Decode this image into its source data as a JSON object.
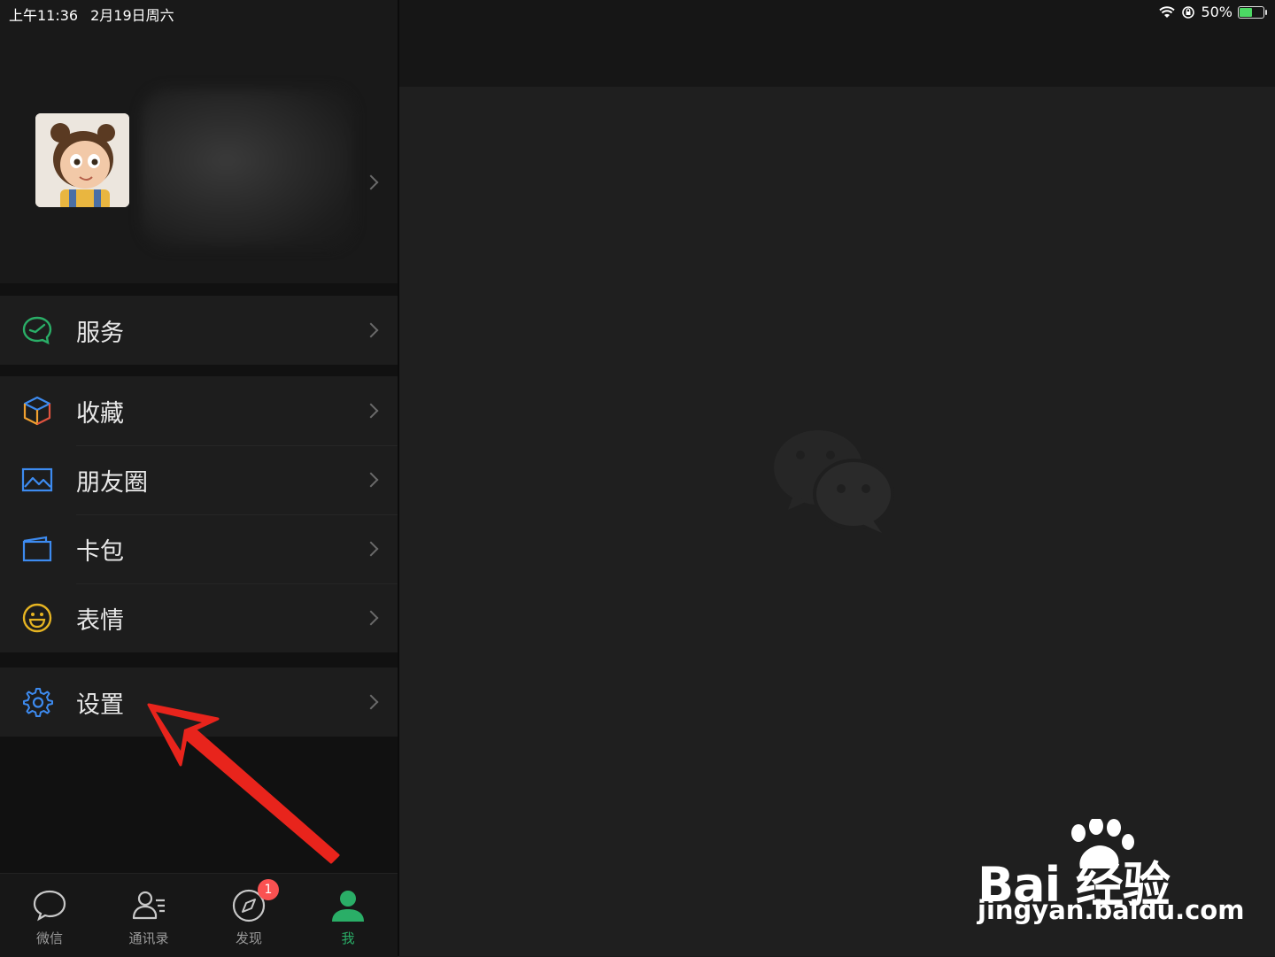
{
  "status": {
    "time": "上午11:36",
    "date": "2月19日周六",
    "battery": "50%",
    "battery_level": 0.5
  },
  "menu": {
    "group1": [
      {
        "label": "服务",
        "icon": "service-icon",
        "color": "#2aae67"
      }
    ],
    "group2": [
      {
        "label": "收藏",
        "icon": "favorites-cube-icon",
        "color": "#f0a030"
      },
      {
        "label": "朋友圈",
        "icon": "moments-picture-icon",
        "color": "#3d8bf0"
      },
      {
        "label": "卡包",
        "icon": "card-wallet-icon",
        "color": "#3d8bf0"
      },
      {
        "label": "表情",
        "icon": "sticker-smile-icon",
        "color": "#e6b422"
      }
    ],
    "group3": [
      {
        "label": "设置",
        "icon": "settings-gear-icon",
        "color": "#3d8bf0"
      }
    ]
  },
  "tabbar": {
    "tabs": [
      {
        "label": "微信",
        "icon": "chat-bubble-icon"
      },
      {
        "label": "通讯录",
        "icon": "contacts-icon"
      },
      {
        "label": "发现",
        "icon": "discover-compass-icon",
        "badge": "1"
      },
      {
        "label": "我",
        "icon": "me-person-icon",
        "active": true
      }
    ]
  },
  "watermark": {
    "line1": "Bai 经验",
    "line2": "jingyan.baidu.com"
  },
  "colors": {
    "accent": "#2aae67",
    "badge": "#fa5151",
    "arrow": "#e8241c"
  }
}
